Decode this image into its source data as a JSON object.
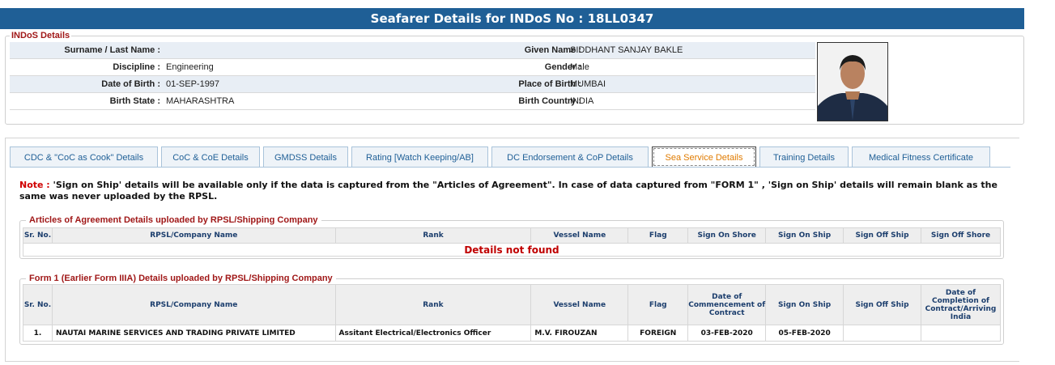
{
  "page": {
    "title": "Seafarer Details for INDoS No : 18LL0347"
  },
  "indos": {
    "legend": "INDoS Details",
    "rows": [
      {
        "l1": "Surname / Last Name :",
        "v1": "",
        "l2": "Given Name :",
        "v2": "SIDDHANT SANJAY BAKLE"
      },
      {
        "l1": "Discipline :",
        "v1": "Engineering",
        "l2": "Gender :",
        "v2": "Male"
      },
      {
        "l1": "Date of Birth :",
        "v1": "01-SEP-1997",
        "l2": "Place of Birth :",
        "v2": "MUMBAI"
      },
      {
        "l1": "Birth State :",
        "v1": "MAHARASHTRA",
        "l2": "Birth Country :",
        "v2": "INDIA"
      }
    ]
  },
  "tabs": [
    {
      "label": "CDC & \"CoC as Cook\" Details"
    },
    {
      "label": "CoC & CoE Details"
    },
    {
      "label": "GMDSS Details"
    },
    {
      "label": "Rating [Watch Keeping/AB]"
    },
    {
      "label": "DC Endorsement & CoP Details"
    },
    {
      "label": "Sea Service Details"
    },
    {
      "label": "Training Details"
    },
    {
      "label": "Medical Fitness Certificate"
    }
  ],
  "note": {
    "label": "Note :",
    "text": " 'Sign on Ship' details will be available only if the data is captured from the \"Articles of Agreement\". In case of data captured from \"FORM 1\" , 'Sign on Ship' details will remain blank as the same was never uploaded by the RPSL."
  },
  "articles": {
    "legend": "Articles of Agreement Details uploaded by RPSL/Shipping Company",
    "headers": [
      "Sr. No.",
      "RPSL/Company Name",
      "Rank",
      "Vessel Name",
      "Flag",
      "Sign On Shore",
      "Sign On Ship",
      "Sign Off Ship",
      "Sign Off Shore"
    ],
    "empty_text": "Details not found"
  },
  "form1": {
    "legend": "Form 1 (Earlier Form IIIA) Details uploaded by RPSL/Shipping Company",
    "headers": [
      "Sr. No.",
      "RPSL/Company Name",
      "Rank",
      "Vessel Name",
      "Flag",
      "Date of Commencement of Contract",
      "Sign On Ship",
      "Sign Off Ship",
      "Date of Completion of Contract/Arriving India"
    ],
    "rows": [
      [
        "1.",
        "NAUTAI MARINE SERVICES AND TRADING PRIVATE LIMITED",
        "Assitant Electrical/Electronics Officer",
        "M.V. FIROUZAN",
        "FOREIGN",
        "03-FEB-2020",
        "05-FEB-2020",
        "",
        ""
      ]
    ]
  }
}
